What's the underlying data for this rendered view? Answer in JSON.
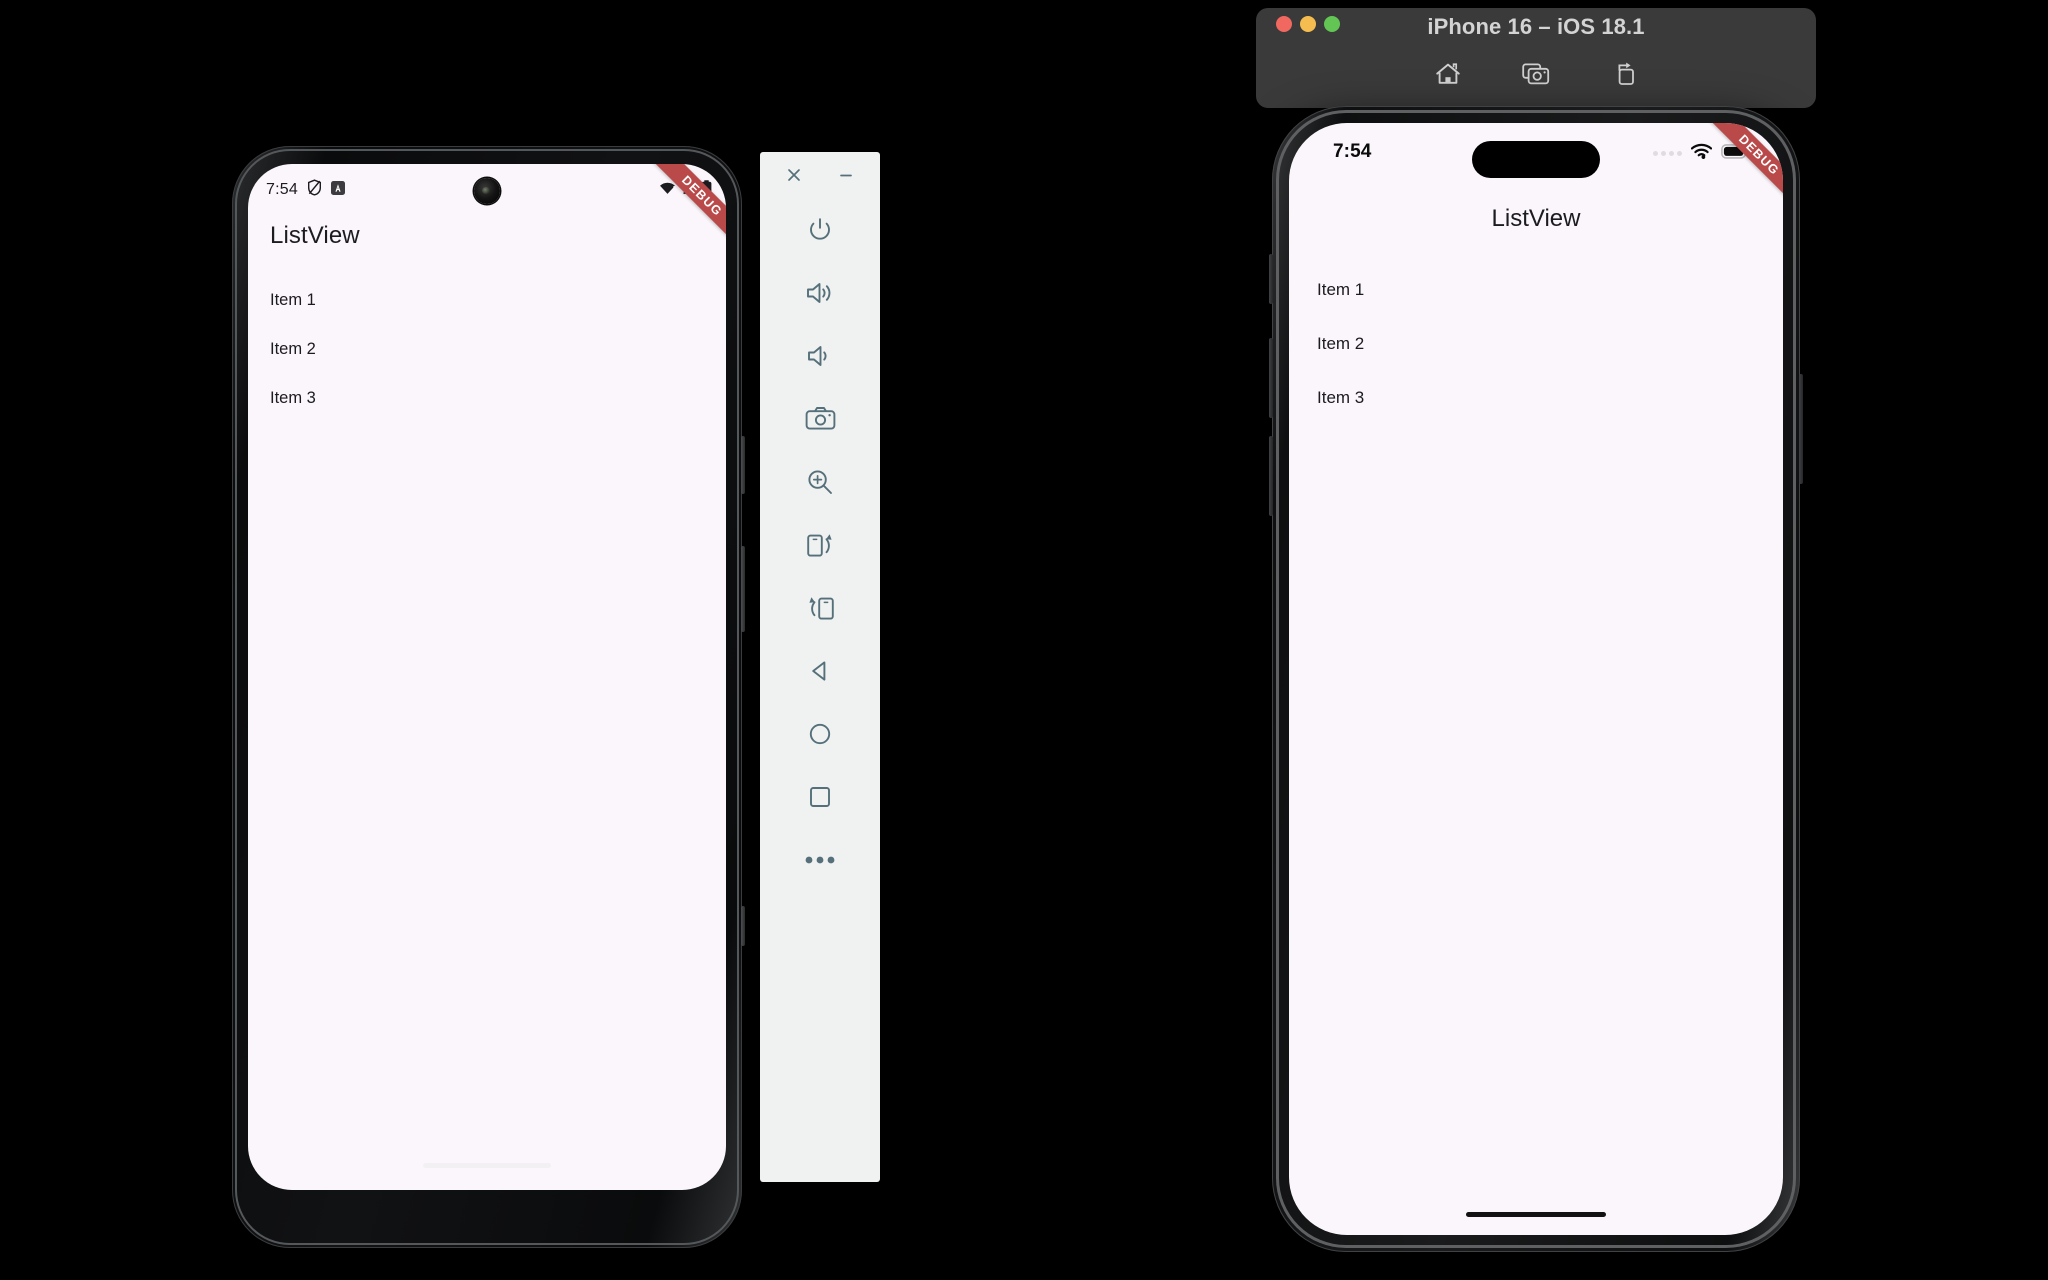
{
  "android_emulator": {
    "name": "android-emulator",
    "status_bar": {
      "time": "7:54",
      "icons": [
        "shield-icon",
        "android-studio-badge-icon",
        "wifi-alert-icon",
        "cellular-signal-icon",
        "battery-icon"
      ]
    },
    "debug_banner": "DEBUG",
    "app": {
      "title": "ListView",
      "items": [
        {
          "label": "Item 1"
        },
        {
          "label": "Item 2"
        },
        {
          "label": "Item 3"
        }
      ]
    }
  },
  "emulator_toolbar": {
    "name": "emulator-toolbar",
    "window_buttons": [
      {
        "id": "close",
        "label": "Close",
        "icon": "close-icon"
      },
      {
        "id": "minimize",
        "label": "Minimize",
        "icon": "minimize-icon"
      }
    ],
    "buttons": [
      {
        "id": "power",
        "label": "Power",
        "icon": "power-icon"
      },
      {
        "id": "volume-up",
        "label": "Volume Up",
        "icon": "volume-up-icon"
      },
      {
        "id": "volume-down",
        "label": "Volume Down",
        "icon": "volume-down-icon"
      },
      {
        "id": "screenshot",
        "label": "Take Screenshot",
        "icon": "camera-icon"
      },
      {
        "id": "zoom",
        "label": "Zoom Mode",
        "icon": "zoom-in-icon"
      },
      {
        "id": "rotate-left",
        "label": "Rotate Left",
        "icon": "rotate-left-icon"
      },
      {
        "id": "rotate-right",
        "label": "Rotate Right",
        "icon": "rotate-right-icon"
      },
      {
        "id": "back",
        "label": "Back",
        "icon": "back-triangle-icon"
      },
      {
        "id": "home",
        "label": "Home",
        "icon": "home-circle-icon"
      },
      {
        "id": "overview",
        "label": "Overview",
        "icon": "overview-square-icon"
      },
      {
        "id": "more",
        "label": "More",
        "icon": "more-dots-icon"
      }
    ],
    "colors": {
      "panel_bg": "#f0f1f1",
      "icon": "#55707a"
    }
  },
  "ios_simulator": {
    "name": "ios-simulator",
    "window": {
      "title": "iPhone 16 – iOS 18.1",
      "traffic_lights": [
        {
          "id": "close",
          "color": "#f0685f"
        },
        {
          "id": "minimize",
          "color": "#f5bd4f"
        },
        {
          "id": "zoom",
          "color": "#62c554"
        }
      ],
      "toolbar_buttons": [
        {
          "id": "home",
          "label": "Home",
          "icon": "home-icon"
        },
        {
          "id": "screenshot",
          "label": "Screenshot",
          "icon": "camera-stack-icon"
        },
        {
          "id": "rotate",
          "label": "Rotate",
          "icon": "rotate-device-icon"
        }
      ],
      "titlebar_bg": "#3a3a3a"
    },
    "status_bar": {
      "time": "7:54",
      "icons": [
        "cellular-dots-icon",
        "wifi-icon",
        "battery-icon"
      ]
    },
    "debug_banner": "DEBUG",
    "app": {
      "title": "ListView",
      "items": [
        {
          "label": "Item 1"
        },
        {
          "label": "Item 2"
        },
        {
          "label": "Item 3"
        }
      ]
    }
  },
  "theme": {
    "screen_bg": "#fbf6fb",
    "text": "#1c1b1f",
    "debug_ribbon": "#ba4a4a",
    "page_bg": "#000000"
  }
}
